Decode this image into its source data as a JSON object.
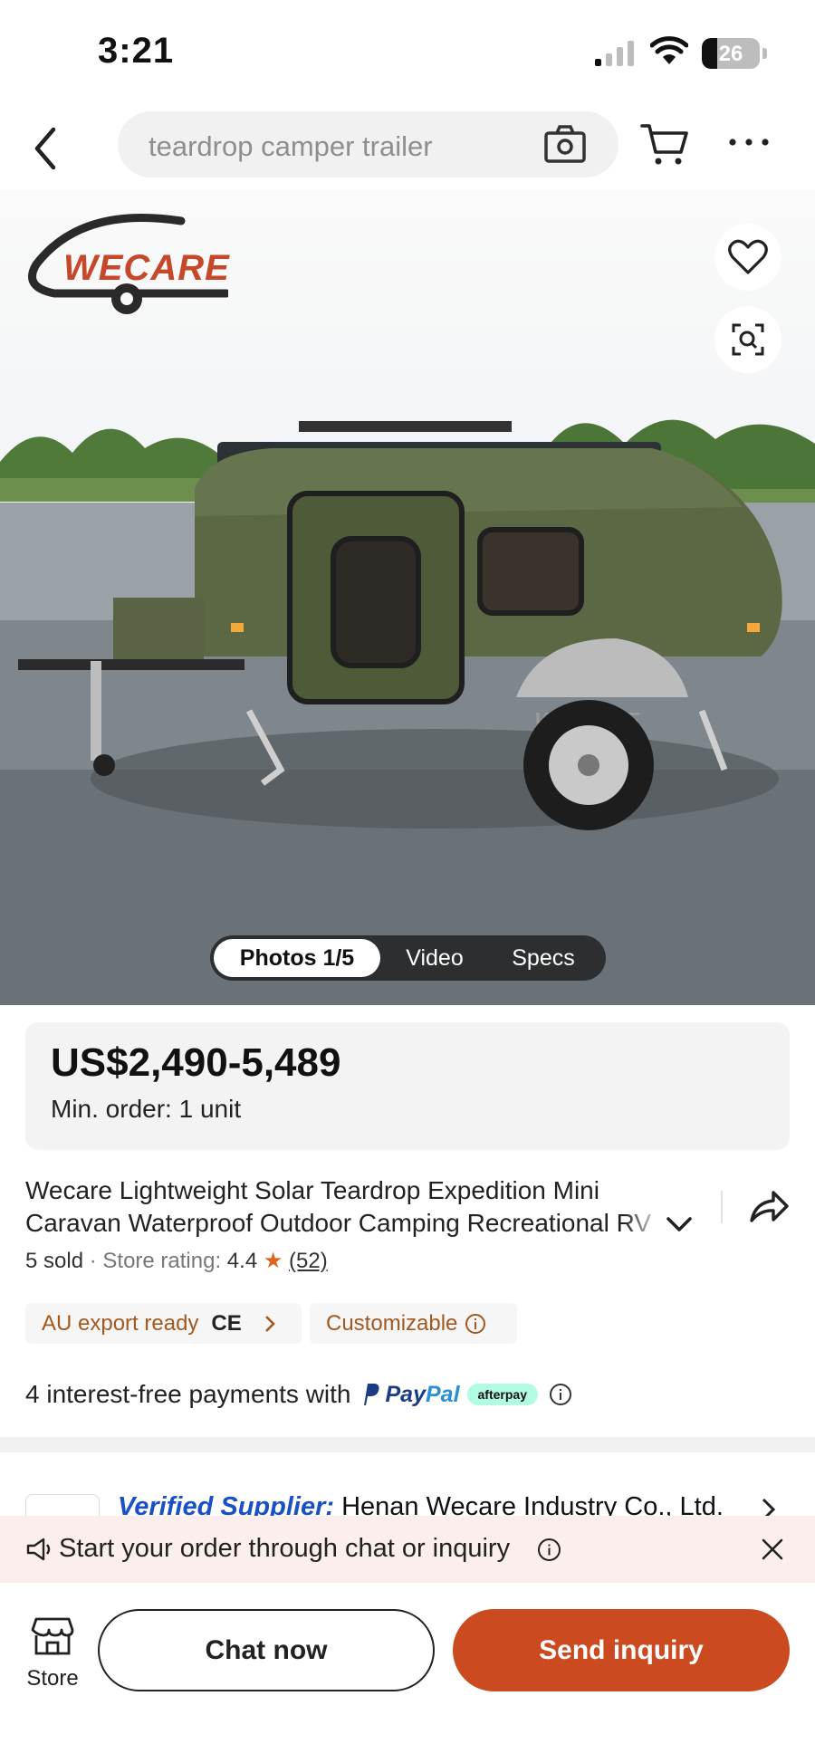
{
  "status_bar": {
    "time": "3:21",
    "battery": "26",
    "battery_level": 0.26,
    "signal_icon": "cellular-signal-icon",
    "wifi_icon": "wifi-icon"
  },
  "header": {
    "search_text": "teardrop camper trailer",
    "icons": [
      "back-chevron-icon",
      "camera-icon",
      "cart-icon",
      "more-dots-icon"
    ]
  },
  "hero": {
    "logo_text": "WECARE",
    "media_tabs": [
      "Photos 1/5",
      "Video",
      "Specs"
    ],
    "icons": [
      "heart-icon",
      "image-search-icon"
    ]
  },
  "product": {
    "price": "US$2,490-5,489",
    "min_order": "Min. order: 1 unit",
    "title": "Wecare Lightweight Solar Teardrop Expedition Mini Caravan Waterproof Outdoor Camping Recreational RV",
    "sold": "5 sold",
    "store_rating_label": "Store rating:",
    "store_rating_value": "4.4",
    "rating_count": "(52)",
    "tags": [
      "AU export ready",
      "Customizable"
    ],
    "ce_mark": "CE",
    "payments_text": "4 interest-free payments with",
    "paypal_first": "Pay",
    "paypal_second": "Pal",
    "afterpay_label": "afterpay"
  },
  "supplier": {
    "verified_label": "Verified Supplier:",
    "name": "Henan Wecare Industry Co., Ltd."
  },
  "notice": {
    "text": "Start your order through chat or inquiry"
  },
  "bottom_bar": {
    "store_label": "Store",
    "chat_label": "Chat now",
    "inquiry_label": "Send inquiry"
  },
  "colors": {
    "accent": "#cc4a1f",
    "tag_text": "#a3581f",
    "verified_blue": "#1a50c7",
    "notice_bg": "#fdeeee"
  }
}
